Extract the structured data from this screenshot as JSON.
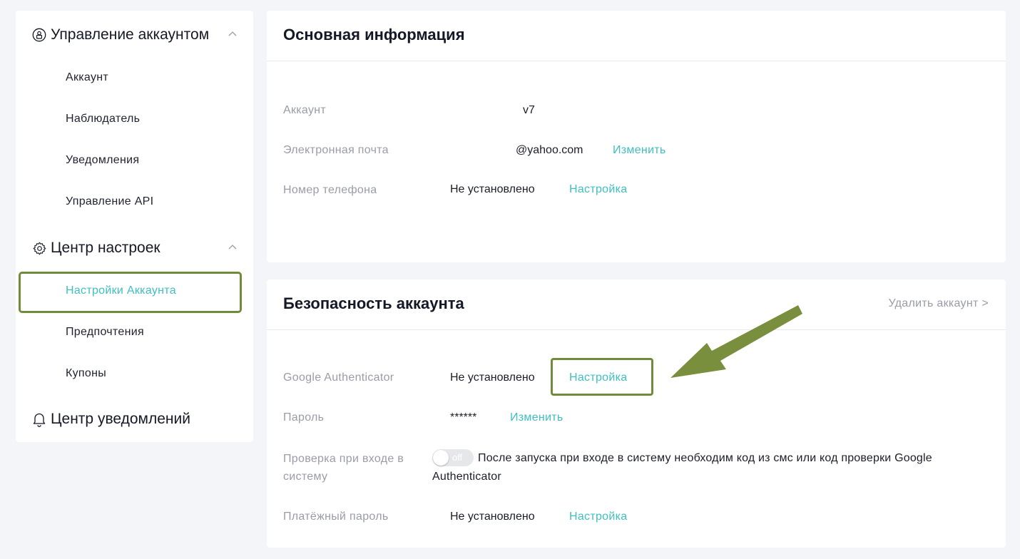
{
  "sidebar": {
    "groups": [
      {
        "title": "Управление аккаунтом",
        "icon": "user-shield-icon",
        "items": [
          "Аккаунт",
          "Наблюдатель",
          "Уведомления",
          "Управление API"
        ]
      },
      {
        "title": "Центр настроек",
        "icon": "gear-icon",
        "items": [
          "Настройки Аккаунта",
          "Предпочтения",
          "Купоны"
        ],
        "active_item": "Настройки Аккаунта"
      },
      {
        "title": "Центр уведомлений",
        "icon": "bell-icon"
      }
    ]
  },
  "basic_info": {
    "title": "Основная информация",
    "rows": [
      {
        "label": "Аккаунт",
        "value": "v7"
      },
      {
        "label": "Электронная почта",
        "value": "@yahoo.com",
        "action": "Изменить"
      },
      {
        "label": "Номер телефона",
        "value": "Не установлено",
        "action": "Настройка"
      }
    ]
  },
  "security": {
    "title": "Безопасность аккаунта",
    "delete_link": "Удалить аккаунт >",
    "rows": [
      {
        "label": "Google Authenticator",
        "value": "Не установлено",
        "action": "Настройка"
      },
      {
        "label": "Пароль",
        "value": "******",
        "action": "Изменить"
      },
      {
        "label": "Проверка при входе в систему",
        "toggle_label": "off",
        "toggle_on": false,
        "description": "После запуска при входе в систему необходим код из смс или код проверки Google Authenticator"
      },
      {
        "label": "Платёжный пароль",
        "value": "Не установлено",
        "action": "Настройка"
      }
    ]
  },
  "colors": {
    "accent": "#3fbfbf",
    "highlight": "#708b3a",
    "muted": "#9a9ca8",
    "background": "#f4f5f8"
  }
}
